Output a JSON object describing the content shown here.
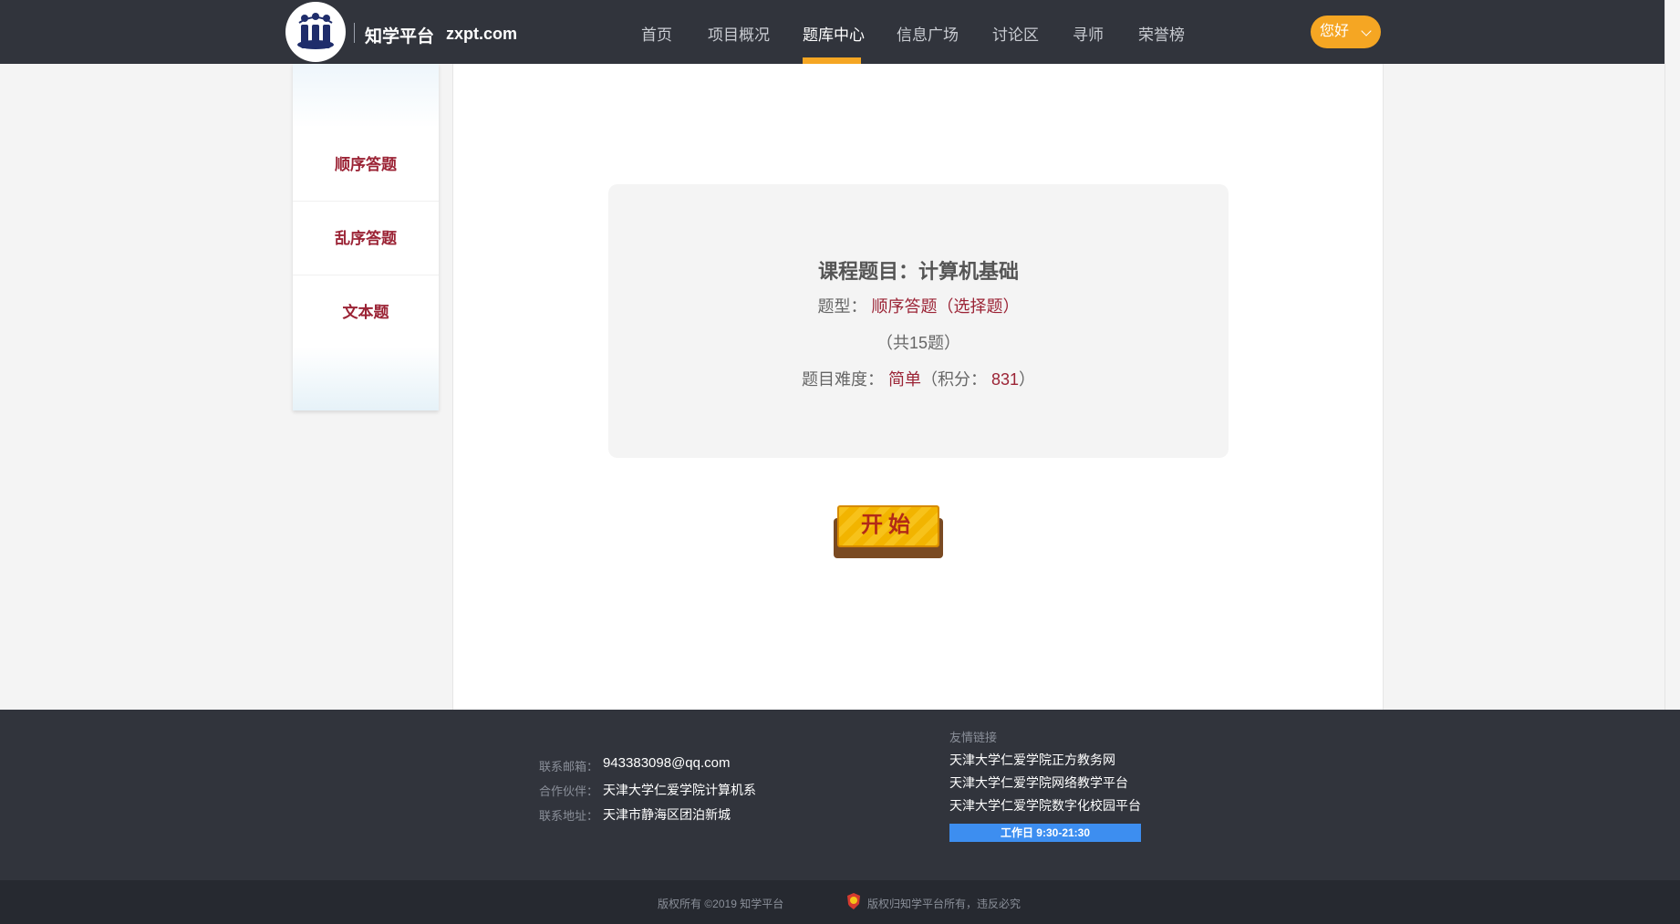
{
  "header": {
    "brand": "知学平台",
    "domain": "zxpt.com",
    "nav": [
      {
        "label": "首页",
        "active": false
      },
      {
        "label": "项目概况",
        "active": false
      },
      {
        "label": "题库中心",
        "active": true
      },
      {
        "label": "信息广场",
        "active": false
      },
      {
        "label": "讨论区",
        "active": false
      },
      {
        "label": "寻师",
        "active": false
      },
      {
        "label": "荣誉榜",
        "active": false
      }
    ],
    "greeting": "您好"
  },
  "sidebar": {
    "items": [
      {
        "label": "顺序答题"
      },
      {
        "label": "乱序答题"
      },
      {
        "label": "文本题"
      }
    ]
  },
  "card": {
    "title": "课程题目：计算机基础",
    "type_label": "题型：",
    "type_value": "顺序答题（选择题）",
    "count": "（共15题）",
    "difficulty_label": "题目难度：",
    "difficulty_value": "简单",
    "points_label": "（积分：",
    "points_value": "831",
    "points_close": "）"
  },
  "start_button": {
    "label": "开始"
  },
  "footer": {
    "contacts": [
      {
        "label": "联系邮箱：",
        "value": "943383098@qq.com"
      },
      {
        "label": "合作伙伴：",
        "value": "天津大学仁爱学院计算机系"
      },
      {
        "label": "联系地址：",
        "value": "天津市静海区团泊新城"
      }
    ],
    "links_title": "友情链接",
    "links": [
      "天津大学仁爱学院正方教务网",
      "天津大学仁爱学院网络教学平台",
      "天津大学仁爱学院数字化校园平台"
    ],
    "hours": "工作日 9:30-21:30",
    "copyright": "版权所有 ©2019 知学平台",
    "rights": "版权归知学平台所有，违反必究"
  },
  "colors": {
    "header_bg": "#31343c",
    "accent": "#f5a623",
    "brand_red": "#9b2335",
    "link_blue": "#3d8ef0"
  }
}
